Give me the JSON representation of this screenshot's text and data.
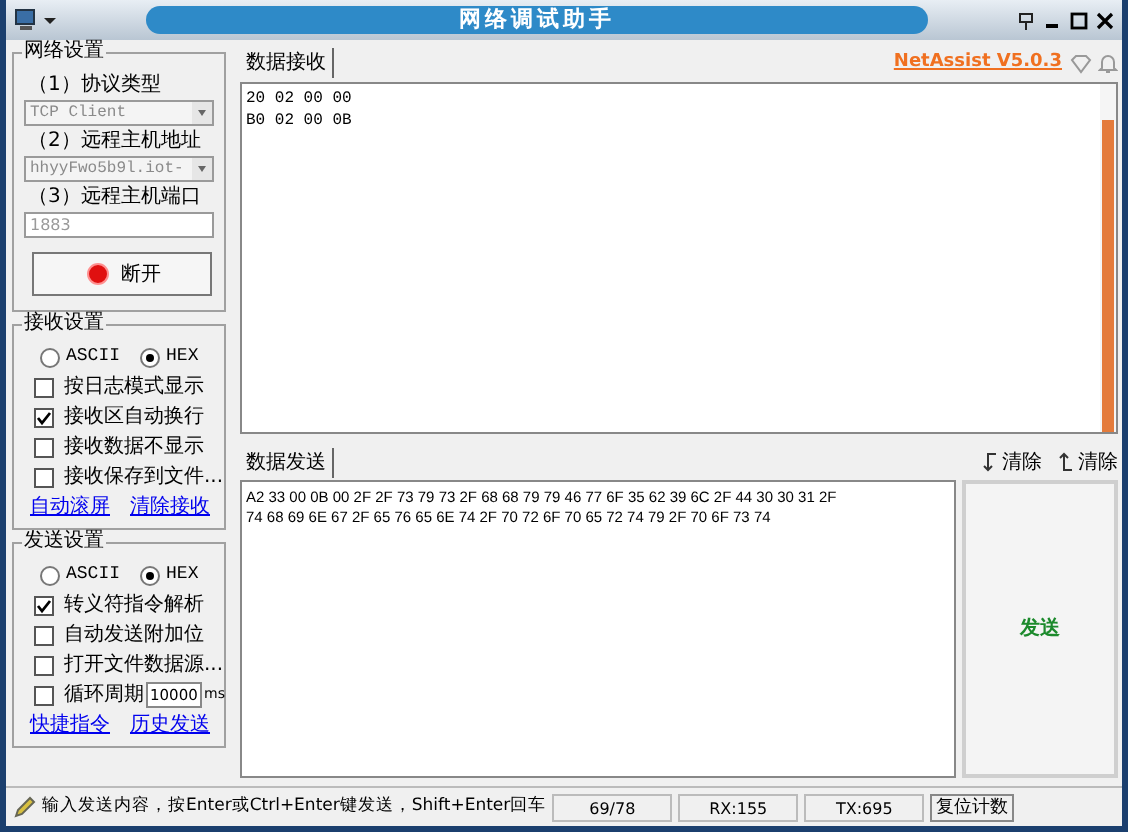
{
  "window": {
    "title": "网络调试助手"
  },
  "network_settings": {
    "title": "网络设置",
    "fields": [
      {
        "label": "（1）协议类型",
        "kind": "select",
        "value": "TCP Client",
        "disabled": true
      },
      {
        "label": "（2）远程主机地址",
        "kind": "select",
        "value": "hhyyFwo5b9l.iot-",
        "disabled": true
      },
      {
        "label": "（3）远程主机端口",
        "kind": "input",
        "value": "1883",
        "disabled": true
      }
    ],
    "connect_button": {
      "label": "断开",
      "connected": true
    }
  },
  "receive_settings": {
    "title": "接收设置",
    "encoding": [
      {
        "label": "ASCII",
        "selected": false
      },
      {
        "label": "HEX",
        "selected": true
      }
    ],
    "options": [
      {
        "label": "按日志模式显示",
        "checked": false
      },
      {
        "label": "接收区自动换行",
        "checked": true
      },
      {
        "label": "接收数据不显示",
        "checked": false
      },
      {
        "label": "接收保存到文件...",
        "checked": false
      }
    ],
    "links": [
      "自动滚屏",
      "清除接收"
    ]
  },
  "send_settings": {
    "title": "发送设置",
    "encoding": [
      {
        "label": "ASCII",
        "selected": false
      },
      {
        "label": "HEX",
        "selected": true
      }
    ],
    "options": [
      {
        "label": "转义符指令解析",
        "checked": true,
        "kind": "info"
      },
      {
        "label": "自动发送附加位",
        "checked": false,
        "kind": "plain"
      },
      {
        "label": "打开文件数据源...",
        "checked": false,
        "kind": "plain"
      },
      {
        "label": "循环周期",
        "checked": false,
        "kind": "period",
        "value": "10000",
        "unit": "ms"
      }
    ],
    "links": [
      "快捷指令",
      "历史发送"
    ]
  },
  "receive_panel": {
    "tab": "数据接收",
    "version": "NetAssist V5.0.3",
    "lines": [
      "20 02 00 00",
      "B0 02 00 0B"
    ]
  },
  "send_panel": {
    "tab": "数据发送",
    "clear_buttons": [
      "清除",
      "清除"
    ],
    "lines": [
      "A2 33 00 0B 00 2F 2F 73 79 73 2F 68 68 79 79 46 77 6F 35 62 39 6C 2F 44 30 30 31 2F",
      "74 68 69 6E 67 2F 65 76 65 6E 74 2F 70 72 6F 70 65 72 74 79 2F 70 6F 73 74"
    ],
    "send_button": "发送"
  },
  "status_bar": {
    "hint": "输入发送内容，按Enter或Ctrl+Enter键发送，Shift+Enter回车",
    "count": "69/78",
    "rx": "RX:155",
    "tx": "TX:695",
    "reset_button": "复位计数"
  }
}
